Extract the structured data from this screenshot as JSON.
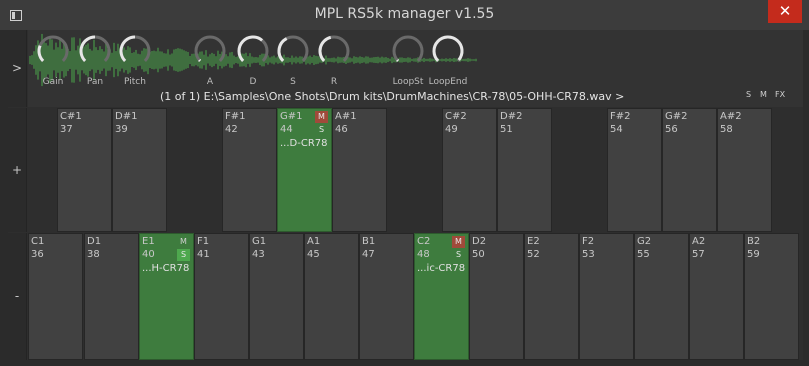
{
  "window": {
    "title": "MPL RS5k manager v1.55",
    "close_label": "✕"
  },
  "side": {
    "expand_label": ">",
    "octave_up_label": "+",
    "octave_down_label": "-"
  },
  "knobs": [
    {
      "label": "Gain",
      "value": 0.25
    },
    {
      "label": "Pan",
      "value": 0.5
    },
    {
      "label": "Pitch",
      "value": 0.5
    },
    {
      "label": "A",
      "value": 0.02
    },
    {
      "label": "D",
      "value": 0.65
    },
    {
      "label": "S",
      "value": 0.4
    },
    {
      "label": "R",
      "value": 0.45
    },
    {
      "label": "LoopSt",
      "value": 0.02
    },
    {
      "label": "LoopEnd",
      "value": 0.98
    }
  ],
  "sample": {
    "path": "(1 of 1) E:\\Samples\\One Shots\\Drum kits\\DrumMachines\\CR-78\\05-OHH-CR78.wav >"
  },
  "flags": {
    "s": "S",
    "m": "M",
    "fx": "FX"
  },
  "pads": [
    {
      "note": "C#1",
      "number": "37",
      "sample": "",
      "active": false,
      "m": "",
      "s": ""
    },
    {
      "note": "D#1",
      "number": "39",
      "sample": "",
      "active": false,
      "m": "",
      "s": ""
    },
    {
      "note": "F#1",
      "number": "42",
      "sample": "",
      "active": false,
      "m": "",
      "s": ""
    },
    {
      "note": "G#1",
      "number": "44",
      "sample": "...D-CR78",
      "active": true,
      "m": "M",
      "s": "S"
    },
    {
      "note": "A#1",
      "number": "46",
      "sample": "",
      "active": false,
      "m": "",
      "s": ""
    },
    {
      "note": "C#2",
      "number": "49",
      "sample": "",
      "active": false,
      "m": "",
      "s": ""
    },
    {
      "note": "D#2",
      "number": "51",
      "sample": "",
      "active": false,
      "m": "",
      "s": ""
    },
    {
      "note": "F#2",
      "number": "54",
      "sample": "",
      "active": false,
      "m": "",
      "s": ""
    },
    {
      "note": "G#2",
      "number": "56",
      "sample": "",
      "active": false,
      "m": "",
      "s": ""
    },
    {
      "note": "A#2",
      "number": "58",
      "sample": "",
      "active": false,
      "m": "",
      "s": ""
    },
    {
      "note": "C1",
      "number": "36",
      "sample": "",
      "active": false,
      "m": "",
      "s": ""
    },
    {
      "note": "D1",
      "number": "38",
      "sample": "",
      "active": false,
      "m": "",
      "s": ""
    },
    {
      "note": "E1",
      "number": "40",
      "sample": "...H-CR78",
      "active": true,
      "m": "M",
      "s": "S"
    },
    {
      "note": "F1",
      "number": "41",
      "sample": "",
      "active": false,
      "m": "",
      "s": ""
    },
    {
      "note": "G1",
      "number": "43",
      "sample": "",
      "active": false,
      "m": "",
      "s": ""
    },
    {
      "note": "A1",
      "number": "45",
      "sample": "",
      "active": false,
      "m": "",
      "s": ""
    },
    {
      "note": "B1",
      "number": "47",
      "sample": "",
      "active": false,
      "m": "",
      "s": ""
    },
    {
      "note": "C2",
      "number": "48",
      "sample": "...ic-CR78",
      "active": true,
      "m": "M",
      "s": "S"
    },
    {
      "note": "D2",
      "number": "50",
      "sample": "",
      "active": false,
      "m": "",
      "s": ""
    },
    {
      "note": "E2",
      "number": "52",
      "sample": "",
      "active": false,
      "m": "",
      "s": ""
    },
    {
      "note": "F2",
      "number": "53",
      "sample": "",
      "active": false,
      "m": "",
      "s": ""
    },
    {
      "note": "G2",
      "number": "55",
      "sample": "",
      "active": false,
      "m": "",
      "s": ""
    },
    {
      "note": "A2",
      "number": "57",
      "sample": "",
      "active": false,
      "m": "",
      "s": ""
    },
    {
      "note": "B2",
      "number": "59",
      "sample": "",
      "active": false,
      "m": "",
      "s": ""
    }
  ],
  "colors": {
    "pad": "#414141",
    "pad_active": "#3e7c3e",
    "mute": "#a04a3a",
    "solo": "#4ea84e",
    "close": "#c42b1c"
  }
}
